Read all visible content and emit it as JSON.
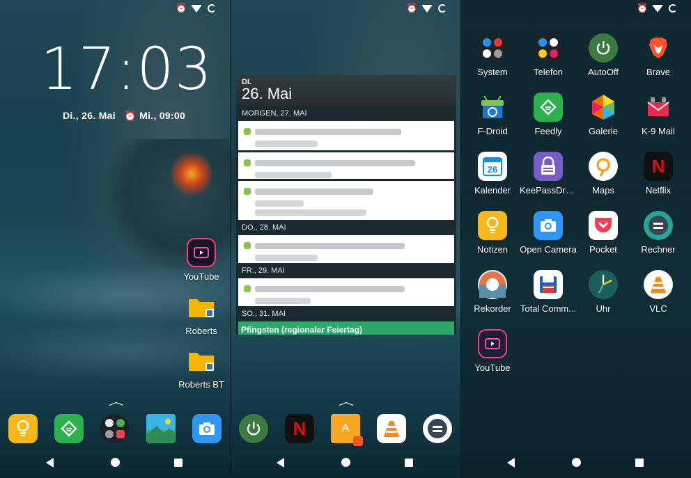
{
  "statusbar": {
    "icons": [
      "alarm-icon",
      "wifi-icon",
      "battery-icon"
    ]
  },
  "lockscreen": {
    "time": "17:03",
    "date": "Di., 26. Mai",
    "alarm": "Mi., 09:00"
  },
  "home": {
    "shortcuts": [
      {
        "label": "YouTube",
        "icon": "youtube-icon"
      },
      {
        "label": "Roberts",
        "icon": "folder-icon"
      },
      {
        "label": "Roberts BT",
        "icon": "folder-icon"
      }
    ],
    "dock": [
      {
        "icon": "bulb-icon",
        "color": "#f5b81c"
      },
      {
        "icon": "feedly-icon",
        "color": "#2bb24c"
      },
      {
        "icon": "folder-group-icon",
        "color": "#1c2328"
      },
      {
        "icon": "gallery-icon",
        "color": "#3aa9dd"
      },
      {
        "icon": "camera-icon",
        "color": "#2e97f3"
      }
    ]
  },
  "calendar": {
    "dow": "DI.",
    "date": "26. Mai",
    "sections": [
      {
        "label": "MORGEN, 27. MAI",
        "events": 3
      },
      {
        "label": "DO., 28. MAI",
        "events": 1
      },
      {
        "label": "FR., 29. MAI",
        "events": 1
      },
      {
        "label": "SO., 31. MAI",
        "events": 0
      }
    ],
    "holiday": "Pfingsten (regionaler Feiertag)"
  },
  "dock2": [
    {
      "icon": "autooff-icon",
      "color": "#3d7a3f"
    },
    {
      "icon": "netflix-icon",
      "color": "#111111"
    },
    {
      "icon": "app-a-icon",
      "color": "#f5a623"
    },
    {
      "icon": "vlc-icon",
      "color": "#ffffff"
    },
    {
      "icon": "calculator-icon",
      "color": "#ffffff"
    }
  ],
  "drawer": [
    {
      "label": "System",
      "icon": "folder-system-icon",
      "color": "#1c2328"
    },
    {
      "label": "Telefon",
      "icon": "folder-phone-icon",
      "color": "#1c2328"
    },
    {
      "label": "AutoOff",
      "icon": "power-icon",
      "color": "#3d7a3f"
    },
    {
      "label": "Brave",
      "icon": "brave-icon",
      "color": "#fb542b"
    },
    {
      "label": "F-Droid",
      "icon": "fdroid-icon",
      "color": "#1976d2"
    },
    {
      "label": "Feedly",
      "icon": "feedly-icon",
      "color": "#2bb24c"
    },
    {
      "label": "Galerie",
      "icon": "gallery-icon",
      "color": "#e94e1b"
    },
    {
      "label": "K-9 Mail",
      "icon": "k9-mail-icon",
      "color": "#e52b50"
    },
    {
      "label": "Kalender",
      "icon": "calendar-icon",
      "color": "#ffffff",
      "text": "26"
    },
    {
      "label": "KeePassDroid",
      "icon": "lock-icon",
      "color": "#7a5cc9"
    },
    {
      "label": "Maps",
      "icon": "maps-icon",
      "color": "#ffffff"
    },
    {
      "label": "Netflix",
      "icon": "netflix-icon",
      "color": "#111111",
      "text": "N"
    },
    {
      "label": "Notizen",
      "icon": "bulb-icon",
      "color": "#f5b81c"
    },
    {
      "label": "Open Camera",
      "icon": "camera-icon",
      "color": "#2e97f3"
    },
    {
      "label": "Pocket",
      "icon": "pocket-icon",
      "color": "#ffffff"
    },
    {
      "label": "Rechner",
      "icon": "calculator-icon",
      "color": "#26a69a"
    },
    {
      "label": "Rekorder",
      "icon": "recorder-icon",
      "color": "#f0f0f0"
    },
    {
      "label": "Total Comm...",
      "icon": "floppy-icon",
      "color": "#ffffff"
    },
    {
      "label": "Uhr",
      "icon": "clock-icon",
      "color": "#1b5e5a"
    },
    {
      "label": "VLC",
      "icon": "vlc-icon",
      "color": "#ffffff"
    },
    {
      "label": "YouTube",
      "icon": "youtube-icon",
      "color": "#1b1f3b"
    }
  ]
}
